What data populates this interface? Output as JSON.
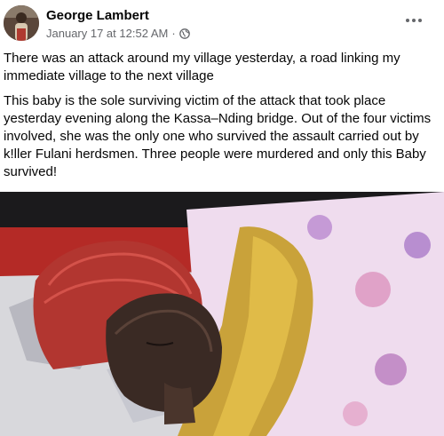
{
  "post": {
    "author": "George Lambert",
    "timestamp": "January 17 at 12:52 AM",
    "separator": "·",
    "privacy_icon": "public-globe-icon",
    "more_icon": "more-options-icon",
    "paragraphs": [
      "There was an attack around my village yesterday, a road linking my immediate village to the next village",
      "This baby is the sole surviving victim of the attack that took place yesterday evening along the Kassa–Nding bridge. Out of the four victims involved, she was the only one who survived the assault carried out by k!ller Fulani herdsmen. Three people were murdered and only this Baby survived!"
    ]
  },
  "colors": {
    "name": "#050505",
    "meta": "#65676b",
    "card": "#ffffff"
  }
}
